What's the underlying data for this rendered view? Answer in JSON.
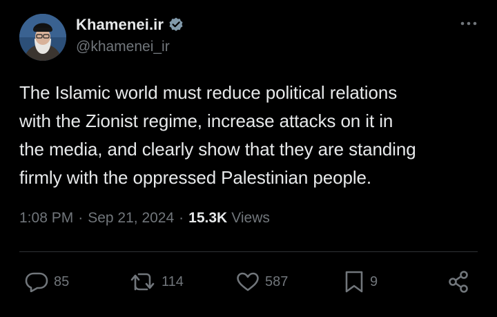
{
  "author": {
    "display_name": "Khamenei.ir",
    "handle": "@khamenei_ir",
    "verified": true
  },
  "tweet": {
    "text": "The Islamic world must reduce political relations\nwith the Zionist regime, increase attacks on it in\nthe media, and clearly show that they are standing\nfirmly with the oppressed Palestinian people."
  },
  "meta": {
    "time": "1:08 PM",
    "separator": "·",
    "date": "Sep 21, 2024",
    "views_count": "15.3K",
    "views_label": "Views"
  },
  "actions": {
    "replies": "85",
    "retweets": "114",
    "likes": "587",
    "bookmarks": "9"
  },
  "icons": {
    "more": "more-dots-icon",
    "reply": "reply-icon",
    "retweet": "retweet-icon",
    "like": "heart-icon",
    "bookmark": "bookmark-icon",
    "share": "share-icon",
    "verified": "verified-badge-icon"
  },
  "colors": {
    "background": "#000000",
    "text_primary": "#e7e9ea",
    "text_secondary": "#71767b",
    "verified_badge": "#829aab",
    "divider": "#2f3336"
  }
}
